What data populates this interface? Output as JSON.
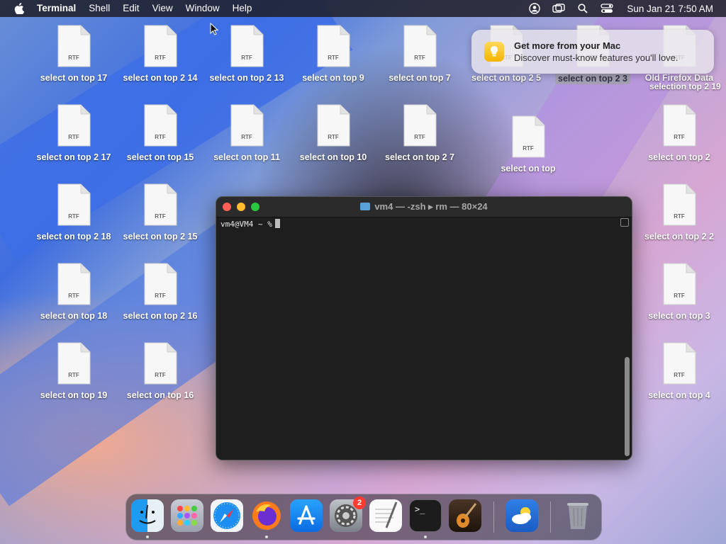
{
  "menubar": {
    "app_name": "Terminal",
    "items": [
      "Shell",
      "Edit",
      "View",
      "Window",
      "Help"
    ],
    "clock": "Sun Jan 21  7:50 AM"
  },
  "notification": {
    "title": "Get more from your Mac",
    "body": "Discover must-know features you'll love."
  },
  "desktop": {
    "file_type_label": "RTF",
    "icons": [
      "select on top 17",
      "select on top 2 14",
      "select on top 2 13",
      "select on top 9",
      "select on top 7",
      "select on top 2 5",
      "select on top 2 3",
      "Old Firefox Data",
      "select on top 2 17",
      "select on top 15",
      "select on top 11",
      "select on top 10",
      "select on top 2 7",
      "select on top",
      "select on top 2",
      "select on top 2 18",
      "select on top 2 15",
      "select on top 2 2",
      "select on top 18",
      "select on top 2 16",
      "select on top 3",
      "select on top 19",
      "select on top 16",
      "select on top 4"
    ],
    "overlap_label": "selection top 2 19"
  },
  "terminal": {
    "title": "vm4 — -zsh ▸ rm — 80×24",
    "prompt": "vm4@VM4 ~ %"
  },
  "dock": {
    "apps": [
      "finder-icon",
      "launchpad-icon",
      "safari-icon",
      "firefox-icon",
      "app-store-icon",
      "system-settings-icon",
      "textedit-icon",
      "terminal-icon",
      "garageband-icon",
      "weather-icon",
      "trash-icon"
    ],
    "settings_badge": "2",
    "terminal_glyph": ">_"
  },
  "colors": {
    "close": "#ff5f57",
    "minimize": "#febc2e",
    "maximize": "#28c840",
    "notification_icon": "#f5b400"
  }
}
